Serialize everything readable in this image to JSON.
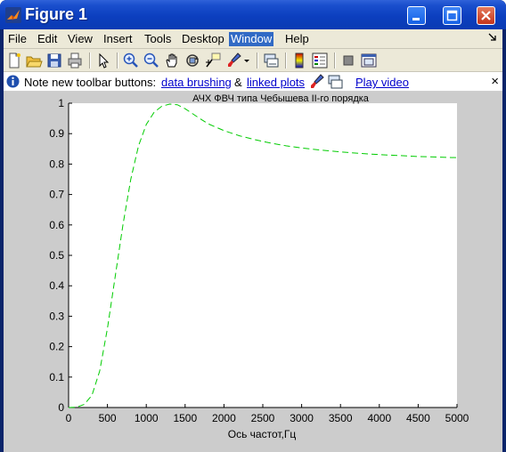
{
  "window": {
    "title": "Figure 1"
  },
  "menu": {
    "items": [
      "File",
      "Edit",
      "View",
      "Insert",
      "Tools",
      "Desktop",
      "Window",
      "Help"
    ],
    "active": "Window"
  },
  "toolbar": {
    "tools": [
      "new-figure-icon",
      "open-file-icon",
      "save-icon",
      "print-icon",
      "edit-plot-arrow-icon",
      "zoom-in-icon",
      "zoom-out-icon",
      "pan-hand-icon",
      "rotate-3d-icon",
      "data-cursor-icon",
      "brush-icon",
      "link-plot-icon",
      "insert-colorbar-icon",
      "insert-legend-icon",
      "hide-plot-tools-icon",
      "show-plot-tools-icon"
    ]
  },
  "notebar": {
    "prefix": "Note new toolbar buttons:",
    "link1": "data brushing",
    "amp": "&",
    "link2": "linked plots",
    "video": "Play video",
    "close": "×"
  },
  "chart_data": {
    "type": "line",
    "title": "АЧХ ФВЧ типа Чебышева II-го порядка",
    "xlabel": "Ось частот,Гц",
    "ylabel": "",
    "xlim": [
      0,
      5000
    ],
    "ylim": [
      0,
      1
    ],
    "xticks": [
      "0",
      "500",
      "1000",
      "1500",
      "2000",
      "2500",
      "3000",
      "3500",
      "4000",
      "4500",
      "5000"
    ],
    "yticks": [
      "0",
      "0.1",
      "0.2",
      "0.3",
      "0.4",
      "0.5",
      "0.6",
      "0.7",
      "0.8",
      "0.9",
      "1"
    ],
    "grid": false,
    "line_style": "dashed",
    "line_color": "#00cc00",
    "series": [
      {
        "x": [
          0,
          100,
          200,
          300,
          400,
          500,
          600,
          700,
          800,
          900,
          1000,
          1100,
          1200,
          1300,
          1400,
          1500,
          1600,
          1700,
          1800,
          2000,
          2200,
          2400,
          2600,
          2800,
          3000,
          3250,
          3500,
          3750,
          4000,
          4250,
          4500,
          4750,
          5000
        ],
        "y": [
          0.0,
          0.001,
          0.01,
          0.04,
          0.12,
          0.26,
          0.43,
          0.6,
          0.75,
          0.86,
          0.93,
          0.97,
          0.99,
          0.997,
          0.995,
          0.982,
          0.965,
          0.948,
          0.932,
          0.91,
          0.893,
          0.88,
          0.869,
          0.86,
          0.853,
          0.846,
          0.84,
          0.835,
          0.831,
          0.828,
          0.825,
          0.823,
          0.821
        ]
      }
    ]
  },
  "colors": {
    "title_bar": "#0c3fbf",
    "chrome": "#ece9d8",
    "figure_bg": "#cccccc",
    "axes_bg": "#ffffff",
    "menu_highlight": "#316ac5",
    "line": "#00cc00"
  }
}
